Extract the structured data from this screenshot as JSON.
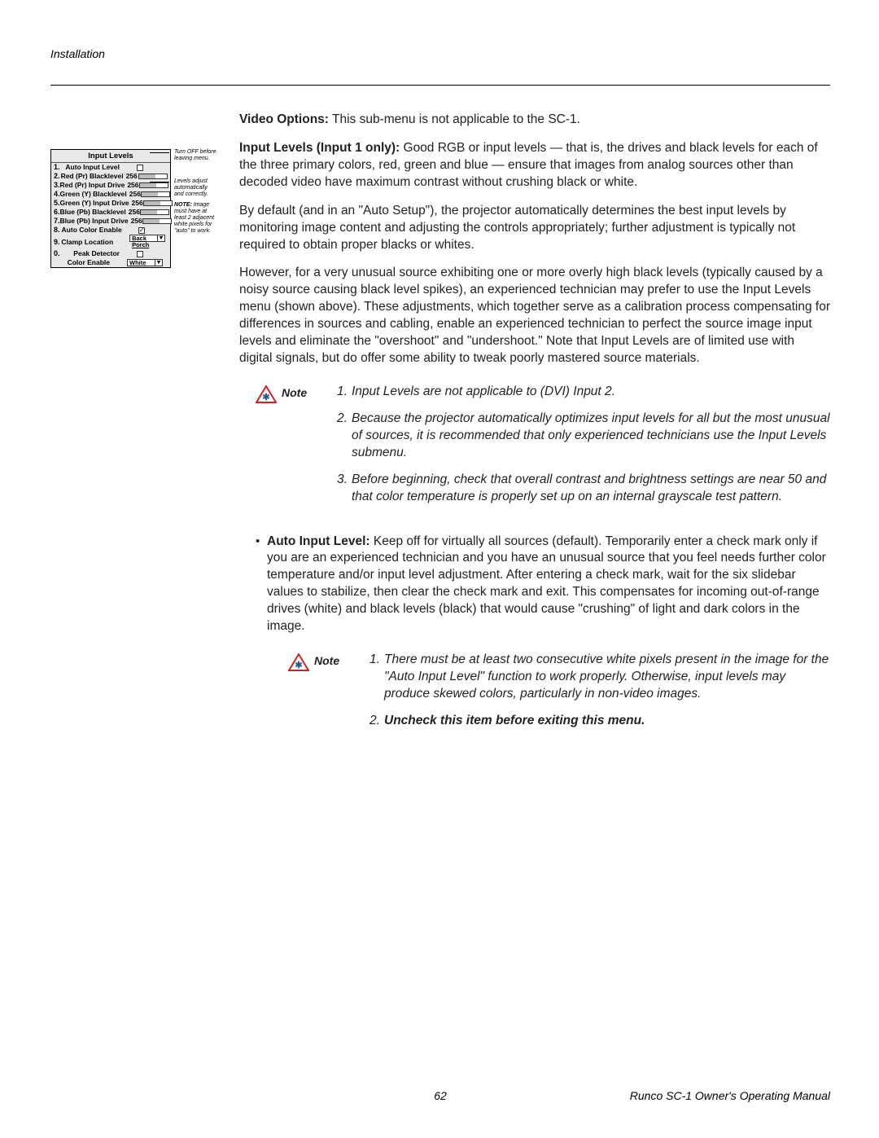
{
  "header": "Installation",
  "menu": {
    "title": "Input Levels",
    "rows": [
      {
        "n": "1.",
        "label": "Auto Input Level",
        "val": "",
        "ctrl": "chk"
      },
      {
        "n": "2.",
        "label": "Red (Pr) Blacklevel",
        "val": "256",
        "ctrl": "slider"
      },
      {
        "n": "3.",
        "label": "Red (Pr) Input Drive",
        "val": "256",
        "ctrl": "slider"
      },
      {
        "n": "4.",
        "label": "Green (Y) Blacklevel",
        "val": "256",
        "ctrl": "slider"
      },
      {
        "n": "5.",
        "label": "Green (Y) Input Drive",
        "val": "256",
        "ctrl": "slider"
      },
      {
        "n": "6.",
        "label": "Blue (Pb) Blacklevel",
        "val": "256",
        "ctrl": "slider"
      },
      {
        "n": "7.",
        "label": "Blue (Pb) Input Drive",
        "val": "256",
        "ctrl": "slider"
      },
      {
        "n": "8.",
        "label": "Auto Color Enable",
        "val": "",
        "ctrl": "chk-checked"
      },
      {
        "n": "9.",
        "label": "Clamp Location",
        "val": "",
        "ctrl": "dd1"
      },
      {
        "n": "0.",
        "label": "Peak Detector",
        "val": "",
        "ctrl": "chk"
      },
      {
        "n": "",
        "label": "Color Enable",
        "val": "",
        "ctrl": "dd2"
      }
    ],
    "dd1": "Back Porch",
    "dd2": "White",
    "anno1": "Turn OFF before leaving menu.",
    "anno2": "Levels adjust automatically and correctly.",
    "anno3_strong": "NOTE:",
    "anno3_rest": " Image must have at least 2 adjacent white pixels for \"auto\" to work."
  },
  "body": {
    "p1_strong": "Video Options:",
    "p1_rest": " This sub-menu is not applicable to the SC-1.",
    "p2_strong": "Input Levels (Input 1 only):",
    "p2_rest": " Good RGB or input levels — that is, the drives and black levels for each of the three primary colors, red, green and blue — ensure that images from analog sources other than decoded video have maximum contrast without crushing black or white.",
    "p3": "By default (and in an \"Auto Setup\"), the projector automatically determines the best input levels by monitoring image content and adjusting the controls appropriately; further adjustment is typically not required to obtain proper blacks or whites.",
    "p4": "However, for a very unusual source exhibiting one or more overly high black levels (typically caused by a noisy source causing black level spikes), an experienced technician may prefer to use the Input Levels menu (shown above). These adjustments, which together serve as a calibration process compensating for differences in sources and cabling, enable an experienced technician to perfect the source image input levels and eliminate the \"overshoot\" and \"undershoot.\" Note that Input Levels are of limited use with digital signals, but do offer some ability to tweak poorly mastered source materials."
  },
  "note1": {
    "label": "Note",
    "i1": "Input Levels are not applicable to (DVI) Input 2.",
    "i2": "Because the projector automatically optimizes input levels for all but the most unusual of sources, it is recommended that only experienced technicians use the Input Levels submenu.",
    "i3": "Before beginning, check that overall contrast and brightness settings are near 50 and that color temperature is properly set up on an internal grayscale test pattern."
  },
  "bullet": {
    "strong": "Auto Input Level:",
    "rest": " Keep off for virtually all sources (default). Temporarily enter a check mark only if you are an experienced technician and you have an unusual source that you feel needs further color temperature and/or input level adjustment. After entering a check mark, wait for the six slidebar values to stabilize, then clear the check mark and exit. This compensates for incoming out-of-range drives (white) and black levels (black) that would cause \"crushing\" of light and dark colors in the image."
  },
  "note2": {
    "label": "Note",
    "i1": "There must be at least two consecutive white pixels present in the image for the \"Auto Input Level\" function to work properly. Otherwise, input levels may produce skewed colors, particularly in non-video images.",
    "i2": "Uncheck this item before exiting this menu."
  },
  "footer": {
    "page": "62",
    "manual": "Runco SC-1 Owner's Operating Manual"
  }
}
